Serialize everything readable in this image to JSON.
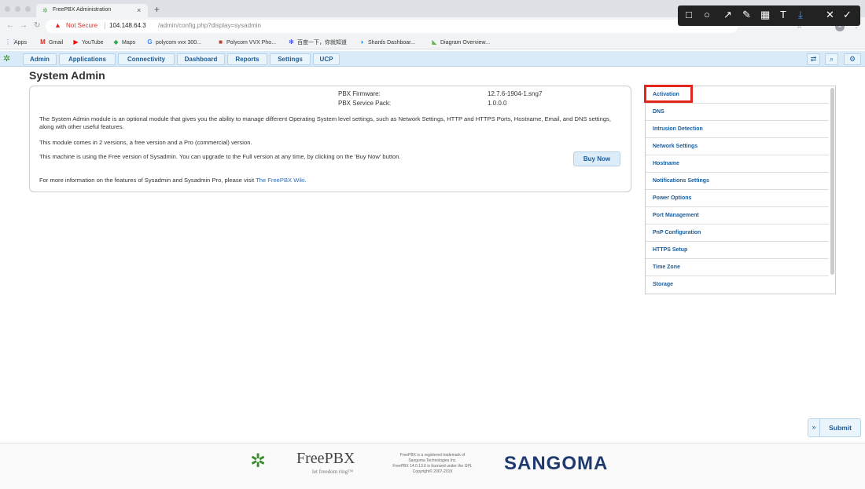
{
  "browser": {
    "tab_title": "FreePBX Administration",
    "new_tab_label": "+",
    "close_label": "×",
    "not_secure": "Not Secure",
    "url_host": "104.148.64.3",
    "url_path": "/admin/config.php?display=sysadmin",
    "profile_initial": "k",
    "bookmarks": [
      {
        "label": "Apps",
        "icon": "apps-grid-icon"
      },
      {
        "label": "Gmail",
        "icon": "gmail-icon"
      },
      {
        "label": "YouTube",
        "icon": "youtube-icon"
      },
      {
        "label": "Maps",
        "icon": "maps-icon"
      },
      {
        "label": "polycom vvx 300...",
        "icon": "google-icon"
      },
      {
        "label": "Polycom VVX Pho...",
        "icon": "polycom-icon"
      },
      {
        "label": "百度一下，你就知道",
        "icon": "baidu-icon"
      },
      {
        "label": "Shards Dashboar...",
        "icon": "shards-icon"
      },
      {
        "label": "Diagram Overview...",
        "icon": "diagram-icon"
      }
    ]
  },
  "nav": {
    "tabs": [
      {
        "label": "Admin"
      },
      {
        "label": "Applications"
      },
      {
        "label": "Connectivity"
      },
      {
        "label": "Dashboard"
      },
      {
        "label": "Reports"
      },
      {
        "label": "Settings"
      },
      {
        "label": "UCP"
      }
    ]
  },
  "page": {
    "title": "System Admin",
    "firmware_label": "PBX Firmware:",
    "firmware_value": "12.7.6-1904-1.sng7",
    "service_pack_label": "PBX Service Pack:",
    "service_pack_value": "1.0.0.0",
    "para1": "The System Admin module is an optional module that gives you the ability to manage different Operating System level settings, such as Network Settings, HTTP and HTTPS Ports, Hostname, Email, and DNS settings, along with other useful features.",
    "para2": "This module comes in 2 versions, a free version and a Pro (commercial) version.",
    "para3": "This machine is using the Free version of Sysadmin. You can upgrade to the Full version at any time, by clicking on the 'Buy Now' button.",
    "para4_prefix": "For more information on the features of Sysadmin and Sysadmin Pro, please visit",
    "para4_link": "The FreePBX Wiki",
    "para4_suffix": ".",
    "buy_now": "Buy Now"
  },
  "right_menu": {
    "items": [
      {
        "label": "Activation"
      },
      {
        "label": "DNS"
      },
      {
        "label": "Intrusion Detection"
      },
      {
        "label": "Network Settings"
      },
      {
        "label": "Hostname"
      },
      {
        "label": "Notifications Settings"
      },
      {
        "label": "Power Options"
      },
      {
        "label": "Port Management"
      },
      {
        "label": "PnP Configuration"
      },
      {
        "label": "HTTPS Setup"
      },
      {
        "label": "Time Zone"
      },
      {
        "label": "Storage"
      }
    ]
  },
  "actions": {
    "submit": "Submit",
    "submit_chevron": "»"
  },
  "footer": {
    "freepbx_name": "FreePBX",
    "freepbx_tagline": "let freedom ring™",
    "legal_1": "FreePBX is a registered trademark of",
    "legal_2": "Sangoma Technologies Inc.",
    "legal_3": "FreePBX 14.0.13.6 is licensed under the GPL",
    "legal_4": "Copyright© 2007-2019",
    "sangoma": "SANGOMA"
  },
  "colors": {
    "nav_bg": "#d9ebf8",
    "link": "#1a5c9a",
    "highlight": "#e4261f"
  }
}
